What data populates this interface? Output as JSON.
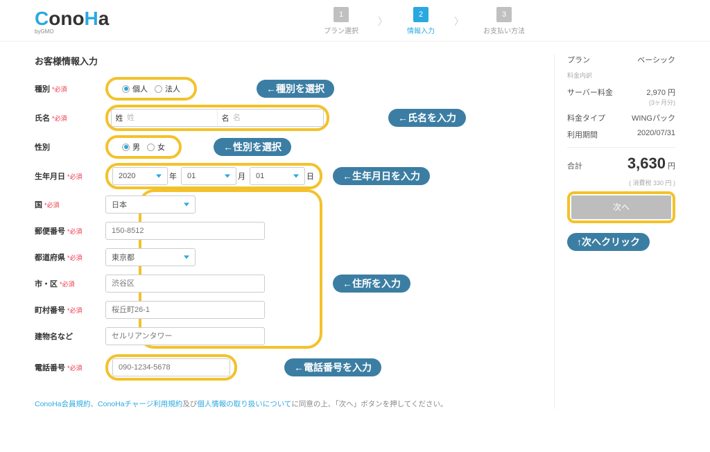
{
  "logo": {
    "text": "ConoHa",
    "sub": "byGMO"
  },
  "steps": [
    {
      "num": "1",
      "label": "プラン選択"
    },
    {
      "num": "2",
      "label": "情報入力"
    },
    {
      "num": "3",
      "label": "お支払い方法"
    }
  ],
  "form": {
    "title": "お客様情報入力",
    "required": "*必須",
    "type": {
      "label": "種別",
      "opt1": "個人",
      "opt2": "法人"
    },
    "name": {
      "label": "氏名",
      "sei_label": "姓",
      "sei_ph": "姓",
      "mei_label": "名",
      "mei_ph": "名"
    },
    "gender": {
      "label": "性別",
      "opt1": "男",
      "opt2": "女"
    },
    "birth": {
      "label": "生年月日",
      "year": "2020",
      "year_unit": "年",
      "month": "01",
      "month_unit": "月",
      "day": "01",
      "day_unit": "日"
    },
    "country": {
      "label": "国",
      "value": "日本"
    },
    "zip": {
      "label": "郵便番号",
      "ph": "150-8512"
    },
    "pref": {
      "label": "都道府県",
      "value": "東京都"
    },
    "city": {
      "label": "市・区",
      "ph": "渋谷区"
    },
    "street": {
      "label": "町村番号",
      "ph": "桜丘町26-1"
    },
    "building": {
      "label": "建物名など",
      "ph": "セルリアンタワー"
    },
    "phone": {
      "label": "電話番号",
      "ph": "090-1234-5678"
    }
  },
  "annotations": {
    "type": "←種別を選択",
    "name": "←氏名を入力",
    "gender": "←性別を選択",
    "birth": "←生年月日を入力",
    "address": "←住所を入力",
    "phone": "←電話番号を入力",
    "next": "↑次へクリック"
  },
  "summary": {
    "plan_label": "プラン",
    "plan_value": "ベーシック",
    "breakdown_label": "料金内訳",
    "server_label": "サーバー料金",
    "server_value": "2,970 円",
    "server_note": "(3ヶ月分)",
    "paytype_label": "料金タイプ",
    "paytype_value": "WINGパック",
    "period_label": "利用期間",
    "period_value": "2020/07/31",
    "total_label": "合計",
    "total_value": "3,630",
    "total_unit": "円",
    "tax_note": "( 消費税 330 円 )",
    "next": "次へ"
  },
  "footnote": {
    "link1": "ConoHa会員規約",
    "sep1": "、",
    "link2": "ConoHaチャージ利用規約",
    "mid": "及び",
    "link3": "個人情報の取り扱いについて",
    "tail": "に同意の上、「次へ」ボタンを押してください。"
  }
}
